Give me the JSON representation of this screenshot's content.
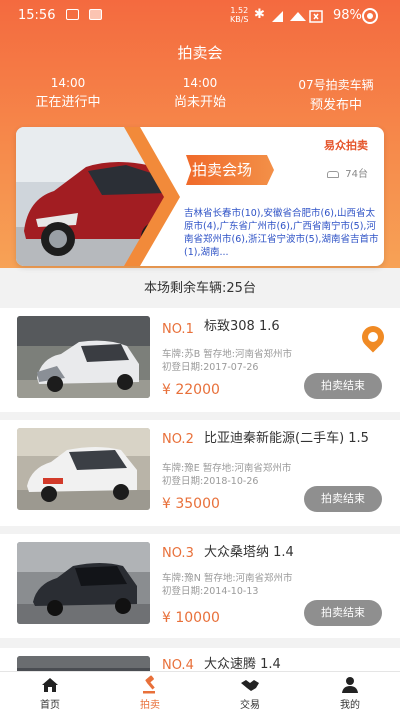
{
  "status_bar": {
    "time": "15:56",
    "net_speed_value": "1.52",
    "net_speed_unit": "KB/S",
    "battery": "98%"
  },
  "header": {
    "title": "拍卖会"
  },
  "stats": [
    {
      "time": "14:00",
      "label": "正在进行中"
    },
    {
      "time": "14:00",
      "label": "尚未开始"
    },
    {
      "time": "07号拍卖车辆",
      "label": "预发布中"
    }
  ],
  "banner": {
    "badge": "拍卖会场",
    "logo": "易众拍卖",
    "count": "74台",
    "cities": "吉林省长春市(10),安徽省合肥市(6),山西省太原市(4),广东省广州市(6),广西省南宁市(5),河南省郑州市(6),浙江省宁波市(5),湖南省吉首市(1),湖南..."
  },
  "remaining": "本场剩余车辆:25台",
  "cards": [
    {
      "no": "NO.1",
      "name": "标致308 1.6",
      "plate": "车牌:苏B 暂存地:河南省郑州市",
      "reg": "初登日期:2017-07-26",
      "price": "¥ 22000",
      "button": "拍卖结束"
    },
    {
      "no": "NO.2",
      "name": "比亚迪秦新能源(二手车) 1.5",
      "plate": "车牌:豫E 暂存地:河南省郑州市",
      "reg": "初登日期:2018-10-26",
      "price": "¥ 35000",
      "button": "拍卖结束"
    },
    {
      "no": "NO.3",
      "name": "大众桑塔纳 1.4",
      "plate": "车牌:豫N 暂存地:河南省郑州市",
      "reg": "初登日期:2014-10-13",
      "price": "¥ 10000",
      "button": "拍卖结束"
    },
    {
      "no": "NO.4",
      "name": "大众速腾 1.4"
    }
  ],
  "nav": [
    {
      "label": "首页",
      "icon": "home-icon"
    },
    {
      "label": "拍卖",
      "icon": "gavel-icon",
      "active": true
    },
    {
      "label": "交易",
      "icon": "handshake-icon"
    },
    {
      "label": "我的",
      "icon": "person-icon"
    }
  ],
  "colors": {
    "accent": "#e8703a",
    "hero_top": "#f46a3f",
    "button_gray": "#8f8f8f",
    "city_text": "#2e52c6"
  }
}
